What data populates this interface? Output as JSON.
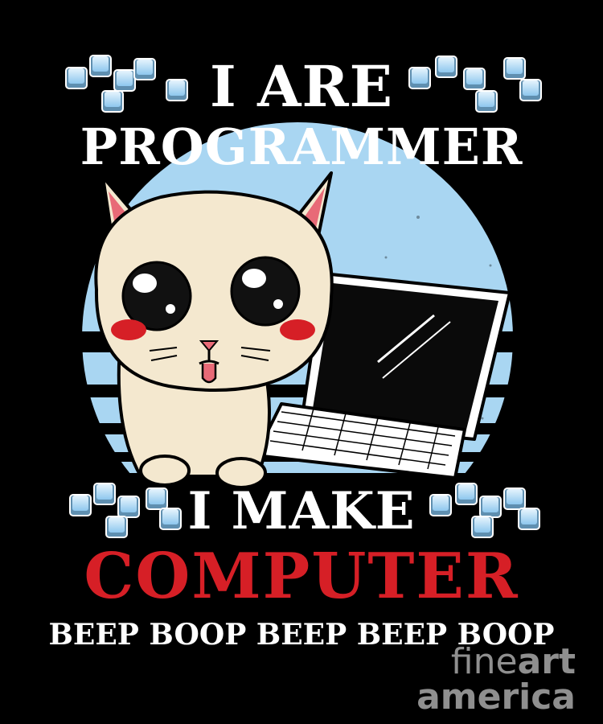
{
  "poster": {
    "line1": "I ARE",
    "line2": "PROGRAMMER",
    "line3": "I MAKE",
    "line4": "COMPUTER",
    "line5": "BEEP BOOP BEEP BEEP BOOP"
  },
  "watermark": {
    "part1": "fine",
    "part2": "art",
    "line2": "america"
  },
  "colors": {
    "background": "#000000",
    "text_white": "#ffffff",
    "accent_red": "#d61f26",
    "sky_blue": "#a9d6f2",
    "cat_fur": "#f4e8cf",
    "keycap_blue": "#bfe0f7"
  },
  "icons": [
    "keycaps-cluster-icon",
    "cat-illustration",
    "laptop-illustration"
  ]
}
